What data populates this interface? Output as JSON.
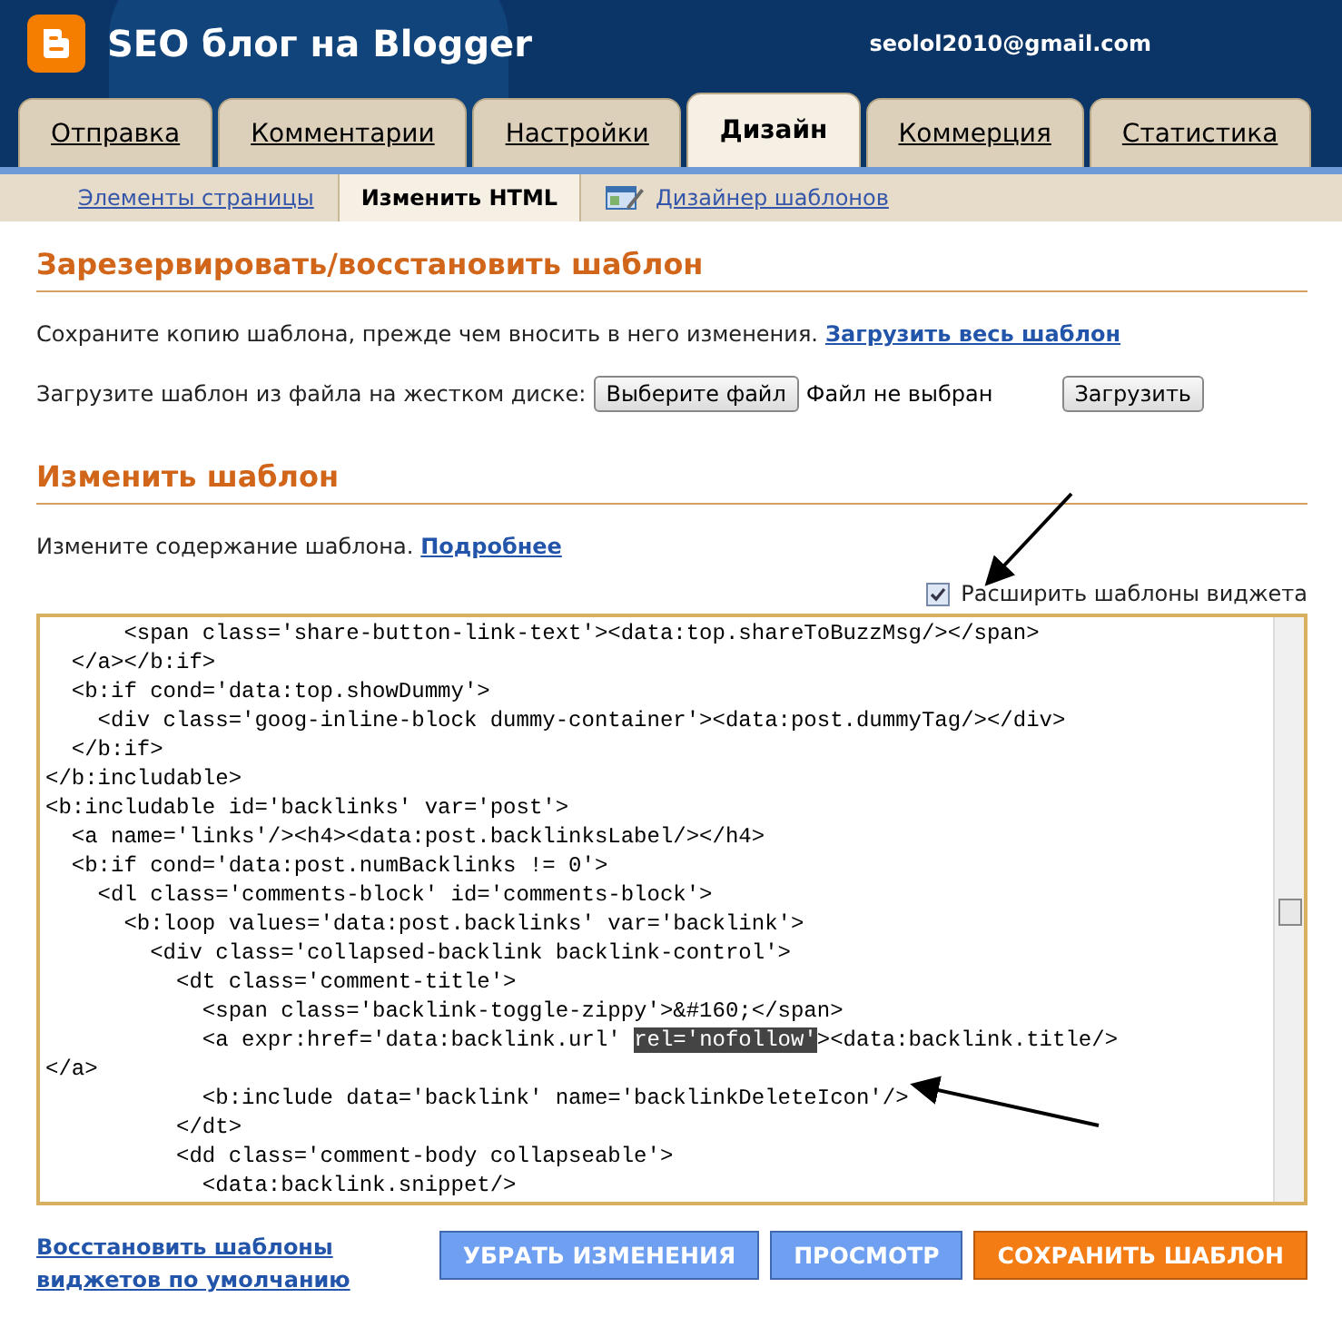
{
  "header": {
    "title": "SEO блог на Blogger",
    "account": "seolol2010@gmail.com"
  },
  "tabs": [
    {
      "label": "Отправка",
      "selected": false
    },
    {
      "label": "Комментарии",
      "selected": false
    },
    {
      "label": "Настройки",
      "selected": false
    },
    {
      "label": "Дизайн",
      "selected": true
    },
    {
      "label": "Коммерция",
      "selected": false
    },
    {
      "label": "Статистика",
      "selected": false
    }
  ],
  "subtabs": [
    {
      "label": "Элементы страницы",
      "selected": false,
      "kind": "link"
    },
    {
      "label": "Изменить HTML",
      "selected": true,
      "kind": "link"
    },
    {
      "label": "Дизайнер шаблонов",
      "selected": false,
      "kind": "designer"
    }
  ],
  "backup": {
    "heading": "Зарезервировать/восстановить шаблон",
    "text": "Сохраните копию шаблона, прежде чем вносить в него изменения.",
    "link": "Загрузить весь шаблон",
    "upload_label": "Загрузите шаблон из файла на жестком диске:",
    "choose_button": "Выберите файл",
    "no_file": "Файл не выбран",
    "upload_button": "Загрузить"
  },
  "edit": {
    "heading": "Изменить шаблон",
    "text": "Измените содержание шаблона.",
    "link": "Подробнее",
    "expand_label": "Расширить шаблоны виджета",
    "expand_checked": true
  },
  "code_lines": [
    {
      "text": "      <span class='share-button-link-text'><data:top.shareToBuzzMsg/></span>"
    },
    {
      "text": "  </a></b:if>"
    },
    {
      "text": "  <b:if cond='data:top.showDummy'>"
    },
    {
      "text": "    <div class='goog-inline-block dummy-container'><data:post.dummyTag/></div>"
    },
    {
      "text": "  </b:if>"
    },
    {
      "text": "</b:includable>"
    },
    {
      "text": "<b:includable id='backlinks' var='post'>"
    },
    {
      "text": "  <a name='links'/><h4><data:post.backlinksLabel/></h4>"
    },
    {
      "text": "  <b:if cond='data:post.numBacklinks != 0'>"
    },
    {
      "text": "    <dl class='comments-block' id='comments-block'>"
    },
    {
      "text": "      <b:loop values='data:post.backlinks' var='backlink'>"
    },
    {
      "text": "        <div class='collapsed-backlink backlink-control'>"
    },
    {
      "text": "          <dt class='comment-title'>"
    },
    {
      "text": "            <span class='backlink-toggle-zippy'>&#160;</span>"
    },
    {
      "text": "            <a expr:href='data:backlink.url' ",
      "highlight": "rel='nofollow'",
      "after": "><data:backlink.title/>"
    },
    {
      "text": "</a>"
    },
    {
      "text": "            <b:include data='backlink' name='backlinkDeleteIcon'/>"
    },
    {
      "text": "          </dt>"
    },
    {
      "text": "          <dd class='comment-body collapseable'>"
    },
    {
      "text": "            <data:backlink.snippet/>"
    }
  ],
  "footer": {
    "restore_link": "Восстановить шаблоны виджетов по умолчанию",
    "buttons": [
      {
        "label": "УБРАТЬ ИЗМЕНЕНИЯ",
        "kind": "secondary"
      },
      {
        "label": "ПРОСМОТР",
        "kind": "secondary"
      },
      {
        "label": "СОХРАНИТЬ ШАБЛОН",
        "kind": "primary"
      }
    ]
  }
}
